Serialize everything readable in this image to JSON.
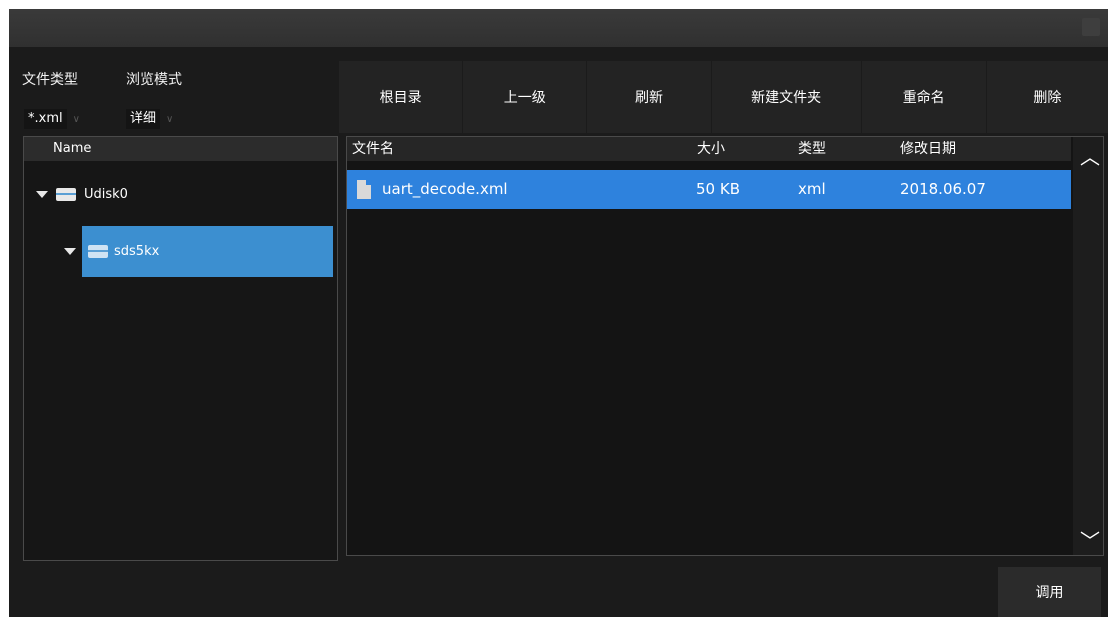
{
  "filters": {
    "file_type_label": "文件类型",
    "file_type_value": "*.xml",
    "browse_mode_label": "浏览模式",
    "browse_mode_value": "详细"
  },
  "toolbar": {
    "root": "根目录",
    "up": "上一级",
    "refresh": "刷新",
    "new_folder": "新建文件夹",
    "rename": "重命名",
    "delete": "删除"
  },
  "tree": {
    "header": "Name",
    "items": [
      {
        "label": "Udisk0"
      },
      {
        "label": "sds5kx"
      }
    ]
  },
  "files": {
    "columns": {
      "name": "文件名",
      "size": "大小",
      "type": "类型",
      "date": "修改日期"
    },
    "rows": [
      {
        "name": "uart_decode.xml",
        "size": "50 KB",
        "type": "xml",
        "date": "2018.06.07"
      }
    ]
  },
  "actions": {
    "recall": "调用"
  },
  "icons": [
    "close-icon",
    "dropdown-arrow-icon",
    "expand-triangle-icon",
    "folder-icon",
    "file-icon",
    "scroll-up-icon",
    "scroll-down-icon"
  ],
  "colors": {
    "selection": "#2e82dd",
    "tree_selection": "#3c8fd0",
    "background": "#1b1b1b"
  }
}
